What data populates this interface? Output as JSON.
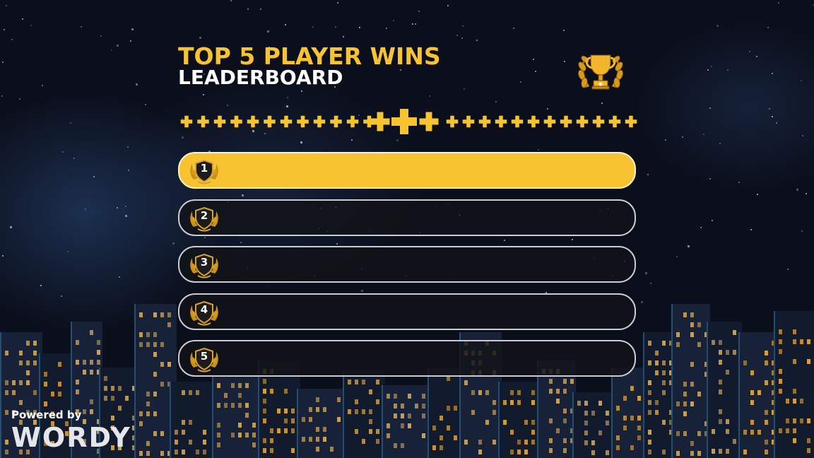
{
  "header": {
    "title": "TOP 5 PLAYER WINS",
    "subtitle": "LEADERBOARD"
  },
  "icons": {
    "trophy": "trophy-laurel-icon",
    "rank_badge": "shield-laurel-badge-icon",
    "divider": "pixel-plus-divider"
  },
  "leaderboard": {
    "rows": [
      {
        "rank": "1",
        "highlighted": true
      },
      {
        "rank": "2",
        "highlighted": false
      },
      {
        "rank": "3",
        "highlighted": false
      },
      {
        "rank": "4",
        "highlighted": false
      },
      {
        "rank": "5",
        "highlighted": false
      }
    ]
  },
  "footer": {
    "powered_by": "Powered by",
    "brand": "WORDY"
  },
  "colors": {
    "accent": "#f7c331",
    "background": "#0b0f1c",
    "row_border": "#c9ccd3",
    "window_light": "#e0a843"
  }
}
